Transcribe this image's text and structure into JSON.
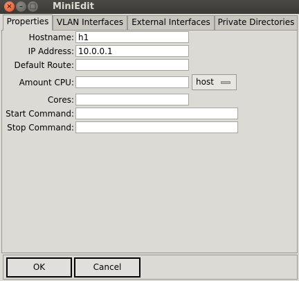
{
  "window": {
    "title": "MiniEdit"
  },
  "tabs": [
    {
      "label": "Properties",
      "active": true
    },
    {
      "label": "VLAN Interfaces",
      "active": false
    },
    {
      "label": "External Interfaces",
      "active": false
    },
    {
      "label": "Private Directories",
      "active": false
    }
  ],
  "form": {
    "hostname_label": "Hostname:",
    "hostname_value": "h1",
    "ip_label": "IP Address:",
    "ip_value": "10.0.0.1",
    "route_label": "Default Route:",
    "route_value": "",
    "cpu_label": "Amount CPU:",
    "cpu_value": "",
    "cpu_mode": "host",
    "cores_label": "Cores:",
    "cores_value": "",
    "start_label": "Start Command:",
    "start_value": "",
    "stop_label": "Stop Command:",
    "stop_value": ""
  },
  "buttons": {
    "ok": "OK",
    "cancel": "Cancel"
  }
}
